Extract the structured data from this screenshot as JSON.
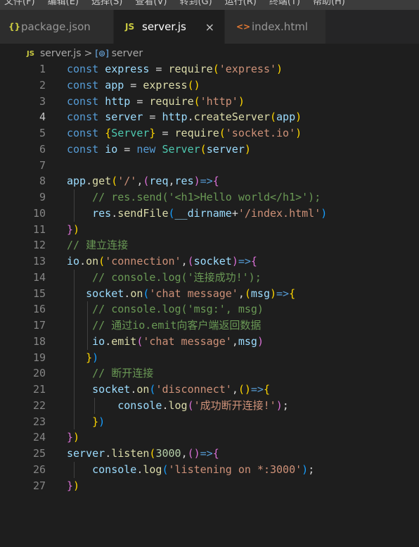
{
  "menubar": {
    "items": [
      "文件(F)",
      "编辑(E)",
      "选择(S)",
      "查看(V)",
      "转到(G)",
      "运行(R)",
      "终端(T)",
      "帮助(H)"
    ]
  },
  "tabs": [
    {
      "icon": "{}",
      "label": "package.json",
      "active": false
    },
    {
      "icon": "JS",
      "label": "server.js",
      "active": true,
      "close": "×"
    },
    {
      "icon": "<>",
      "label": "index.html",
      "active": false
    }
  ],
  "breadcrumb": {
    "file_icon": "JS",
    "file": "server.js",
    "separator": ">",
    "symbol_icon": "[⊚]",
    "symbol": "server"
  },
  "lines": [
    {
      "n": "1",
      "tokens": [
        [
          "k",
          "const "
        ],
        [
          "v",
          "express"
        ],
        [
          "o",
          " = "
        ],
        [
          "f",
          "require"
        ],
        [
          "p1",
          "("
        ],
        [
          "s",
          "'express'"
        ],
        [
          "p1",
          ")"
        ]
      ]
    },
    {
      "n": "2",
      "tokens": [
        [
          "k",
          "const "
        ],
        [
          "v",
          "app"
        ],
        [
          "o",
          " = "
        ],
        [
          "f",
          "express"
        ],
        [
          "p1",
          "()"
        ]
      ]
    },
    {
      "n": "3",
      "tokens": [
        [
          "k",
          "const "
        ],
        [
          "v",
          "http"
        ],
        [
          "o",
          " = "
        ],
        [
          "f",
          "require"
        ],
        [
          "p1",
          "("
        ],
        [
          "s",
          "'http'"
        ],
        [
          "p1",
          ")"
        ]
      ]
    },
    {
      "n": "4",
      "current": true,
      "tokens": [
        [
          "k",
          "const "
        ],
        [
          "v",
          "server"
        ],
        [
          "o",
          " = "
        ],
        [
          "v",
          "http"
        ],
        [
          "o",
          "."
        ],
        [
          "f",
          "createServer"
        ],
        [
          "p1",
          "("
        ],
        [
          "v",
          "app"
        ],
        [
          "p1",
          ")"
        ]
      ]
    },
    {
      "n": "5",
      "tokens": [
        [
          "k",
          "const "
        ],
        [
          "p1",
          "{"
        ],
        [
          "t",
          "Server"
        ],
        [
          "p1",
          "}"
        ],
        [
          "o",
          " = "
        ],
        [
          "f",
          "require"
        ],
        [
          "p1",
          "("
        ],
        [
          "s",
          "'socket.io'"
        ],
        [
          "p1",
          ")"
        ]
      ]
    },
    {
      "n": "6",
      "tokens": [
        [
          "k",
          "const "
        ],
        [
          "v",
          "io"
        ],
        [
          "o",
          " = "
        ],
        [
          "k",
          "new "
        ],
        [
          "t",
          "Server"
        ],
        [
          "p1",
          "("
        ],
        [
          "v",
          "server"
        ],
        [
          "p1",
          ")"
        ]
      ]
    },
    {
      "n": "7",
      "tokens": []
    },
    {
      "n": "8",
      "tokens": [
        [
          "v",
          "app"
        ],
        [
          "o",
          "."
        ],
        [
          "f",
          "get"
        ],
        [
          "p1",
          "("
        ],
        [
          "s",
          "'/'"
        ],
        [
          "o",
          ","
        ],
        [
          "p2",
          "("
        ],
        [
          "v",
          "req"
        ],
        [
          "o",
          ","
        ],
        [
          "v",
          "res"
        ],
        [
          "p2",
          ")"
        ],
        [
          "k",
          "=>"
        ],
        [
          "p2",
          "{"
        ]
      ]
    },
    {
      "n": "9",
      "tokens": [
        [
          "o",
          "    "
        ],
        [
          "c",
          "// res.send('<h1>Hello world</h1>');"
        ]
      ]
    },
    {
      "n": "10",
      "tokens": [
        [
          "o",
          "    "
        ],
        [
          "v",
          "res"
        ],
        [
          "o",
          "."
        ],
        [
          "f",
          "sendFile"
        ],
        [
          "p3",
          "("
        ],
        [
          "v",
          "__dirname"
        ],
        [
          "o",
          "+"
        ],
        [
          "s",
          "'/index.html'"
        ],
        [
          "p3",
          ")"
        ]
      ]
    },
    {
      "n": "11",
      "tokens": [
        [
          "p2",
          "}"
        ],
        [
          "p1",
          ")"
        ]
      ]
    },
    {
      "n": "12",
      "tokens": [
        [
          "c",
          "// 建立连接"
        ]
      ]
    },
    {
      "n": "13",
      "tokens": [
        [
          "v",
          "io"
        ],
        [
          "o",
          "."
        ],
        [
          "f",
          "on"
        ],
        [
          "p1",
          "("
        ],
        [
          "s",
          "'connection'"
        ],
        [
          "o",
          ","
        ],
        [
          "p2",
          "("
        ],
        [
          "v",
          "socket"
        ],
        [
          "p2",
          ")"
        ],
        [
          "k",
          "=>"
        ],
        [
          "p2",
          "{"
        ]
      ]
    },
    {
      "n": "14",
      "tokens": [
        [
          "o",
          "    "
        ],
        [
          "c",
          "// console.log('连接成功!');"
        ]
      ]
    },
    {
      "n": "15",
      "tokens": [
        [
          "o",
          "   "
        ],
        [
          "v",
          "socket"
        ],
        [
          "o",
          "."
        ],
        [
          "f",
          "on"
        ],
        [
          "p3",
          "("
        ],
        [
          "s",
          "'chat message'"
        ],
        [
          "o",
          ","
        ],
        [
          "p1",
          "("
        ],
        [
          "v",
          "msg"
        ],
        [
          "p1",
          ")"
        ],
        [
          "k",
          "=>"
        ],
        [
          "p1",
          "{"
        ]
      ]
    },
    {
      "n": "16",
      "tokens": [
        [
          "o",
          "    "
        ],
        [
          "c",
          "// console.log('msg:', msg)"
        ]
      ]
    },
    {
      "n": "17",
      "tokens": [
        [
          "o",
          "    "
        ],
        [
          "c",
          "// 通过io.emit向客户端返回数据"
        ]
      ]
    },
    {
      "n": "18",
      "tokens": [
        [
          "o",
          "    "
        ],
        [
          "v",
          "io"
        ],
        [
          "o",
          "."
        ],
        [
          "f",
          "emit"
        ],
        [
          "p2",
          "("
        ],
        [
          "s",
          "'chat message'"
        ],
        [
          "o",
          ","
        ],
        [
          "v",
          "msg"
        ],
        [
          "p2",
          ")"
        ]
      ]
    },
    {
      "n": "19",
      "tokens": [
        [
          "o",
          "   "
        ],
        [
          "p1",
          "}"
        ],
        [
          "p3",
          ")"
        ]
      ]
    },
    {
      "n": "20",
      "tokens": [
        [
          "o",
          "    "
        ],
        [
          "c",
          "// 断开连接"
        ]
      ]
    },
    {
      "n": "21",
      "tokens": [
        [
          "o",
          "    "
        ],
        [
          "v",
          "socket"
        ],
        [
          "o",
          "."
        ],
        [
          "f",
          "on"
        ],
        [
          "p3",
          "("
        ],
        [
          "s",
          "'disconnect'"
        ],
        [
          "o",
          ","
        ],
        [
          "p1",
          "()"
        ],
        [
          "k",
          "=>"
        ],
        [
          "p1",
          "{"
        ]
      ]
    },
    {
      "n": "22",
      "tokens": [
        [
          "o",
          "        "
        ],
        [
          "v",
          "console"
        ],
        [
          "o",
          "."
        ],
        [
          "f",
          "log"
        ],
        [
          "p2",
          "("
        ],
        [
          "s",
          "'成功断开连接!'"
        ],
        [
          "p2",
          ")"
        ],
        [
          "o",
          ";"
        ]
      ]
    },
    {
      "n": "23",
      "tokens": [
        [
          "o",
          "    "
        ],
        [
          "p1",
          "}"
        ],
        [
          "p3",
          ")"
        ]
      ]
    },
    {
      "n": "24",
      "tokens": [
        [
          "p2",
          "}"
        ],
        [
          "p1",
          ")"
        ]
      ]
    },
    {
      "n": "25",
      "tokens": [
        [
          "v",
          "server"
        ],
        [
          "o",
          "."
        ],
        [
          "f",
          "listen"
        ],
        [
          "p1",
          "("
        ],
        [
          "n",
          "3000"
        ],
        [
          "o",
          ","
        ],
        [
          "p2",
          "()"
        ],
        [
          "k",
          "=>"
        ],
        [
          "p2",
          "{"
        ]
      ]
    },
    {
      "n": "26",
      "tokens": [
        [
          "o",
          "    "
        ],
        [
          "v",
          "console"
        ],
        [
          "o",
          "."
        ],
        [
          "f",
          "log"
        ],
        [
          "p3",
          "("
        ],
        [
          "s",
          "'listening on *:3000'"
        ],
        [
          "p3",
          ")"
        ],
        [
          "o",
          ";"
        ]
      ]
    },
    {
      "n": "27",
      "tokens": [
        [
          "p2",
          "}"
        ],
        [
          "p1",
          ")"
        ]
      ]
    }
  ]
}
